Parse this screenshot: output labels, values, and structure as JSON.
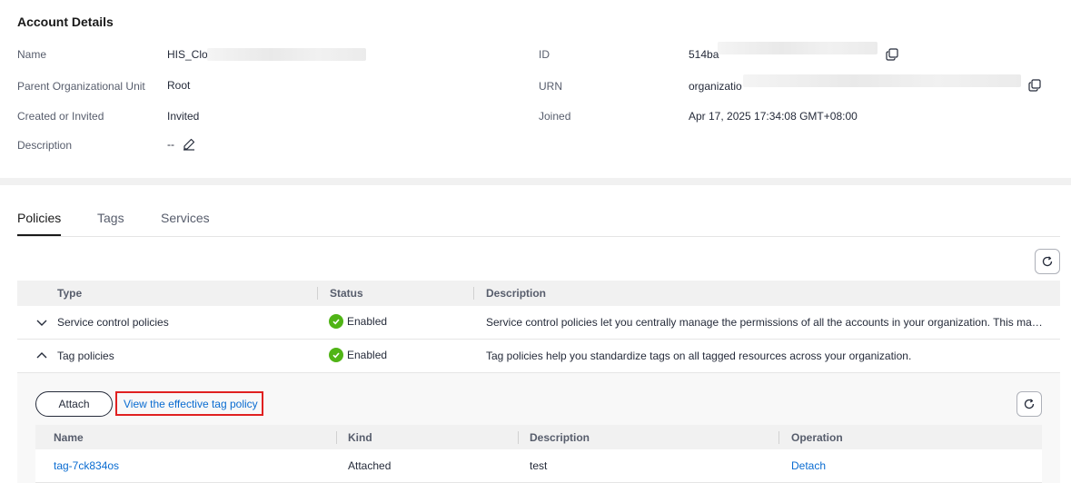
{
  "account": {
    "title": "Account Details",
    "name_label": "Name",
    "name_value": "HIS_Clo",
    "id_label": "ID",
    "id_value": "514ba",
    "parent_label": "Parent Organizational Unit",
    "parent_value": "Root",
    "urn_label": "URN",
    "urn_value": "organizatio",
    "created_label": "Created or Invited",
    "created_value": "Invited",
    "joined_label": "Joined",
    "joined_value": "Apr 17, 2025 17:34:08 GMT+08:00",
    "description_label": "Description",
    "description_value": "--"
  },
  "tabs": [
    {
      "label": "Policies",
      "active": true
    },
    {
      "label": "Tags",
      "active": false
    },
    {
      "label": "Services",
      "active": false
    }
  ],
  "table": {
    "headers": [
      "Type",
      "Status",
      "Description"
    ],
    "rows": [
      {
        "type": "Service control policies",
        "status": "Enabled",
        "description": "Service control policies let you centrally manage the permissions of all the accounts in your organization. This ma…",
        "expanded": false
      },
      {
        "type": "Tag policies",
        "status": "Enabled",
        "description": "Tag policies help you standardize tags on all tagged resources across your organization.",
        "expanded": true
      }
    ]
  },
  "expanded_panel": {
    "attach_label": "Attach",
    "effective_link_label": "View the effective tag policy",
    "headers": [
      "Name",
      "Kind",
      "Description",
      "Operation"
    ],
    "rows": [
      {
        "name": "tag-7ck834os",
        "kind": "Attached",
        "description": "test",
        "operation": "Detach"
      }
    ]
  },
  "colors": {
    "link": "#0a6cd1",
    "success": "#50b416",
    "highlight_border": "#e02020"
  }
}
